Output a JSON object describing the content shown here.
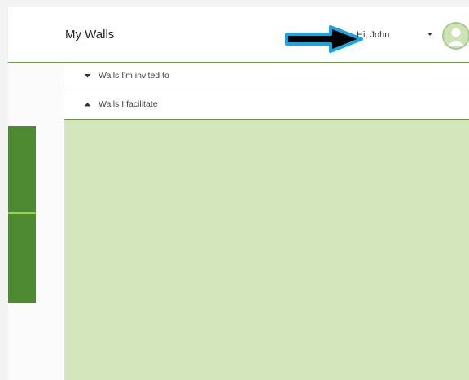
{
  "header": {
    "title": "My Walls",
    "greeting": "Hi, John"
  },
  "icons": {
    "annotation": "arrow-right-icon",
    "user_menu": "caret-down-icon",
    "avatar": "user-avatar-icon"
  },
  "sections": [
    {
      "label": "Walls I'm invited to",
      "state": "collapsed"
    },
    {
      "label": "Walls I facilitate",
      "state": "expanded"
    }
  ],
  "colors": {
    "accent_green": "#4e8a31",
    "content_background": "#d4e6bc",
    "highlight_blue": "#19a4e6"
  }
}
